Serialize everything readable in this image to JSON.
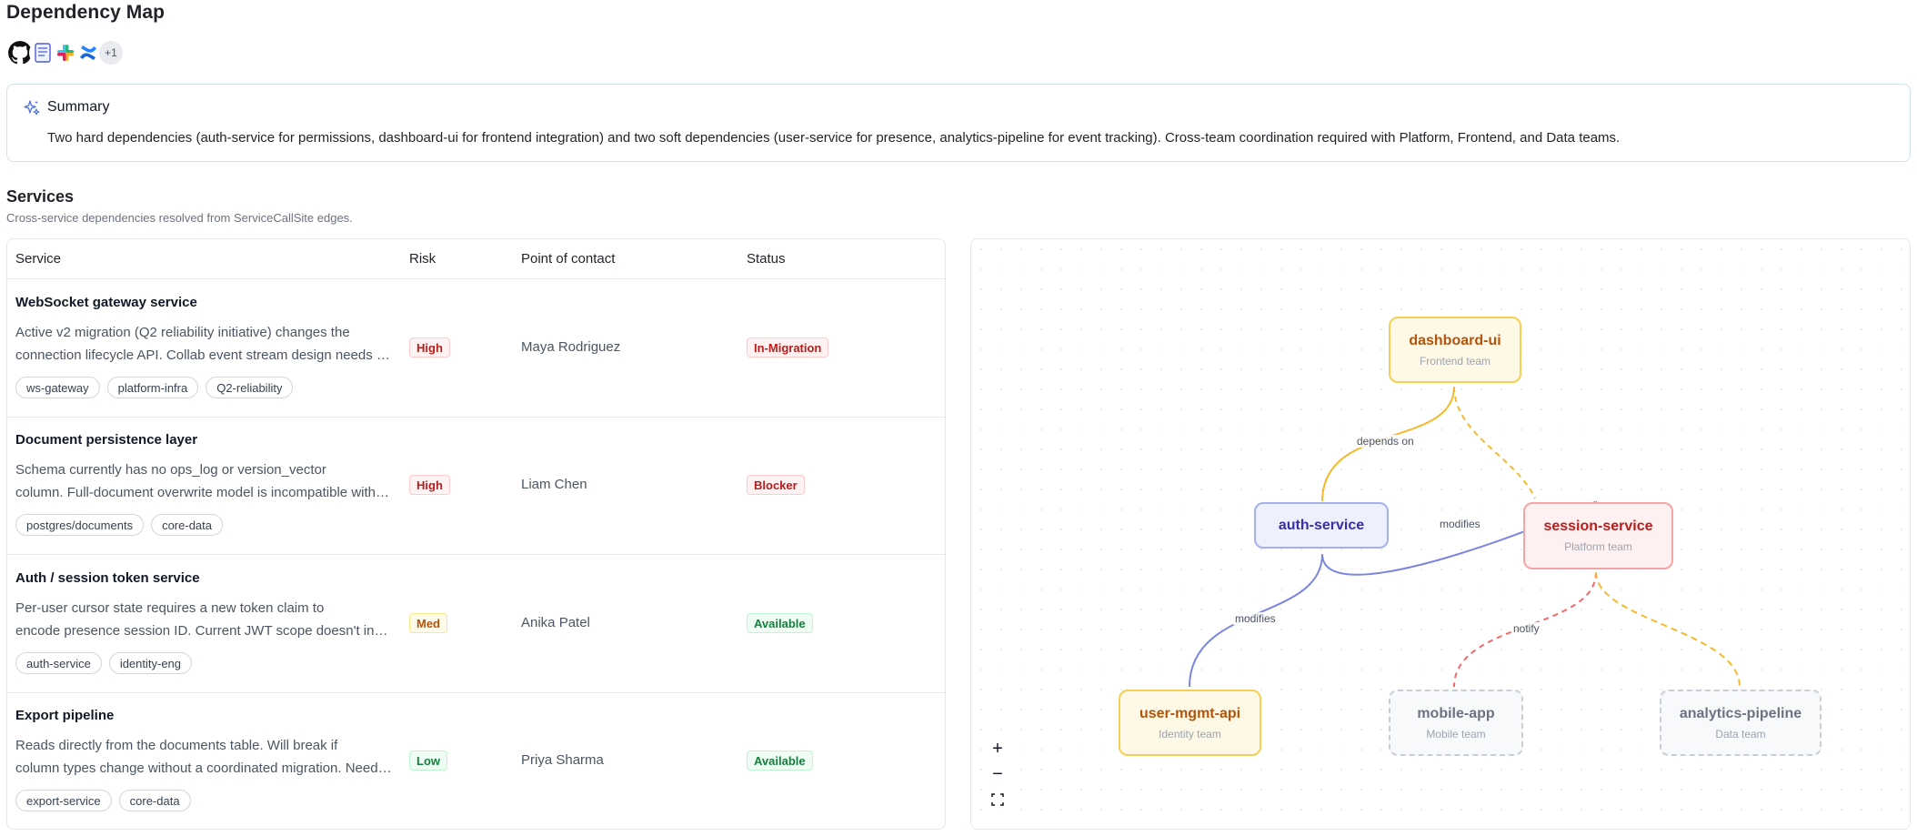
{
  "page": {
    "title": "Dependency Map"
  },
  "integrations": {
    "icons": [
      "github-icon",
      "notes-icon",
      "slack-icon",
      "confluence-icon"
    ],
    "more": "+1"
  },
  "summary": {
    "title": "Summary",
    "text": "Two hard dependencies (auth-service for permissions, dashboard-ui for frontend integration) and two soft dependencies (user-service for presence, analytics-pipeline for event tracking). Cross-team coordination required with Platform, Frontend, and Data teams."
  },
  "services": {
    "title": "Services",
    "subtitle": "Cross-service dependencies resolved from ServiceCallSite edges.",
    "columns": {
      "service": "Service",
      "risk": "Risk",
      "contact": "Point of contact",
      "status": "Status"
    },
    "rows": [
      {
        "name": "WebSocket gateway service",
        "desc1": "Active v2 migration (Q2 reliability initiative) changes the",
        "desc2": "connection lifecycle API. Collab event stream design needs to align with the new API.",
        "tags": [
          "ws-gateway",
          "platform-infra",
          "Q2-reliability"
        ],
        "risk": "High",
        "contact": "Maya Rodriguez",
        "status": "In-Migration"
      },
      {
        "name": "Document persistence layer",
        "desc1": "Schema currently has no ops_log or version_vector",
        "desc2": "column. Full-document overwrite model is incompatible with operational transforms.",
        "tags": [
          "postgres/documents",
          "core-data"
        ],
        "risk": "High",
        "contact": "Liam Chen",
        "status": "Blocker"
      },
      {
        "name": "Auth / session token service",
        "desc1": "Per-user cursor state requires a new token claim to",
        "desc2": "encode presence session ID. Current JWT scope doesn't include presence claims.",
        "tags": [
          "auth-service",
          "identity-eng"
        ],
        "risk": "Med",
        "contact": "Anika Patel",
        "status": "Available"
      },
      {
        "name": "Export pipeline",
        "desc1": "Reads directly from the documents table. Will break if",
        "desc2": "column types change without a coordinated migration. Needs versioned read path.",
        "tags": [
          "export-service",
          "core-data"
        ],
        "risk": "Low",
        "contact": "Priya Sharma",
        "status": "Available"
      }
    ]
  },
  "graph": {
    "nodes": {
      "dashboard_ui": {
        "name": "dashboard-ui",
        "team": "Frontend team"
      },
      "auth_service": {
        "name": "auth-service",
        "team": ""
      },
      "session_service": {
        "name": "session-service",
        "team": "Platform team"
      },
      "user_mgmt_api": {
        "name": "user-mgmt-api",
        "team": "Identity team"
      },
      "mobile_app": {
        "name": "mobile-app",
        "team": "Mobile team"
      },
      "analytics_pipeline": {
        "name": "analytics-pipeline",
        "team": "Data team"
      }
    },
    "edges": {
      "depends_on": "depends on",
      "modifies_1": "modifies",
      "modifies_2": "modifies",
      "notify": "notify"
    },
    "colors": {
      "yellow": "#f5b82e",
      "blue": "#7b86e0",
      "red": "#f06a6a",
      "gray": "#c9ced6"
    },
    "controls": {
      "zoom_in": "+",
      "zoom_out": "−"
    }
  }
}
